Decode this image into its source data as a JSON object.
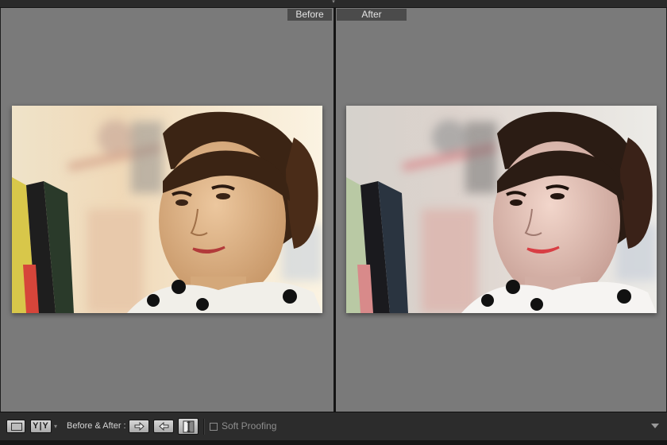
{
  "panes": {
    "before_label": "Before",
    "after_label": "After"
  },
  "toolbar": {
    "loupe_view_icon": "rectangle-icon",
    "yy_label": "Y|Y",
    "before_after_label": "Before & After :",
    "copy_before_to_after_icon": "arrow-right-icon",
    "copy_after_to_before_icon": "arrow-left-icon",
    "swap_icon": "swap-arrows-icon",
    "soft_proofing_label": "Soft Proofing",
    "soft_proofing_checked": false
  },
  "colors": {
    "pane_bg": "#7a7a7a",
    "toolbar_bg": "#2c2c2c",
    "label_bg": "#4b4b4b"
  }
}
